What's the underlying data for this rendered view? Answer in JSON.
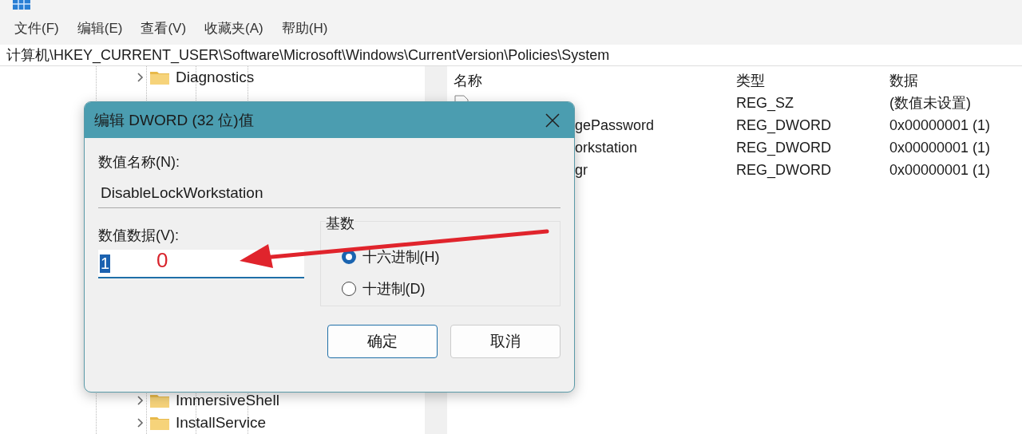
{
  "menu": [
    "文件(F)",
    "编辑(E)",
    "查看(V)",
    "收藏夹(A)",
    "帮助(H)"
  ],
  "address": "计算机\\HKEY_CURRENT_USER\\Software\\Microsoft\\Windows\\CurrentVersion\\Policies\\System",
  "tree": {
    "top_items": [
      "Diagnostics"
    ],
    "bottom_items": [
      "ImmersiveShell",
      "InstallService"
    ]
  },
  "list": {
    "columns": [
      "名称",
      "类型",
      "数据"
    ],
    "rows": [
      {
        "kind": "string",
        "type": "REG_SZ",
        "data": "(数值未设置)"
      },
      {
        "kind": "partial",
        "name": "gePassword",
        "type": "REG_DWORD",
        "data": "0x00000001 (1)"
      },
      {
        "kind": "partial",
        "name": "orkstation",
        "type": "REG_DWORD",
        "data": "0x00000001 (1)"
      },
      {
        "kind": "partial",
        "name": "gr",
        "type": "REG_DWORD",
        "data": "0x00000001 (1)"
      }
    ]
  },
  "dialog": {
    "title": "编辑 DWORD (32 位)值",
    "name_label": "数值名称(N):",
    "name_value": "DisableLockWorkstation",
    "data_label": "数值数据(V):",
    "data_value": "1",
    "data_selected": true,
    "base_label": "基数",
    "radios": [
      {
        "label": "十六进制(H)",
        "selected": true
      },
      {
        "label": "十进制(D)",
        "selected": false
      }
    ],
    "buttons": [
      {
        "label": "确定",
        "focused": true
      },
      {
        "label": "取消",
        "focused": false
      }
    ]
  },
  "annotation": {
    "text": "0"
  }
}
